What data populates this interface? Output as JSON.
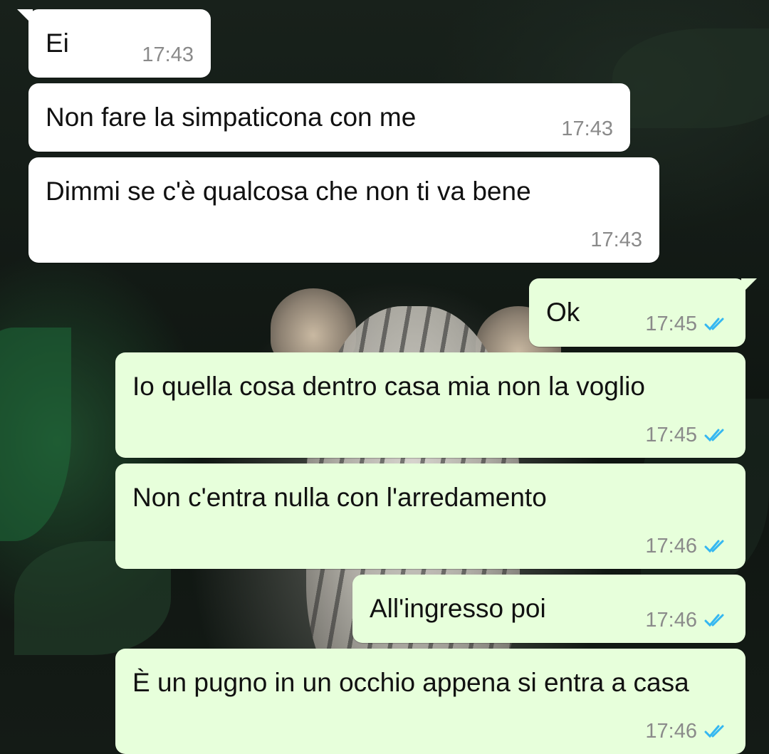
{
  "colors": {
    "incoming_bubble": "#ffffff",
    "outgoing_bubble": "#e7ffdb",
    "timestamp": "#8a8a8a",
    "read_tick": "#34b7f1"
  },
  "messages": [
    {
      "direction": "incoming",
      "text": "Ei",
      "time": "17:43"
    },
    {
      "direction": "incoming",
      "text": "Non fare la simpaticona con me",
      "time": "17:43"
    },
    {
      "direction": "incoming",
      "text": "Dimmi se c'è qualcosa che non ti va bene",
      "time": "17:43"
    },
    {
      "direction": "outgoing",
      "text": "Ok",
      "time": "17:45",
      "status": "read"
    },
    {
      "direction": "outgoing",
      "text": "Io quella cosa dentro casa mia non la voglio",
      "time": "17:45",
      "status": "read"
    },
    {
      "direction": "outgoing",
      "text": "Non c'entra nulla con l'arredamento",
      "time": "17:46",
      "status": "read"
    },
    {
      "direction": "outgoing",
      "text": "All'ingresso poi",
      "time": "17:46",
      "status": "read"
    },
    {
      "direction": "outgoing",
      "text": "È un pugno in un occhio appena si entra a casa",
      "time": "17:46",
      "status": "read"
    }
  ]
}
